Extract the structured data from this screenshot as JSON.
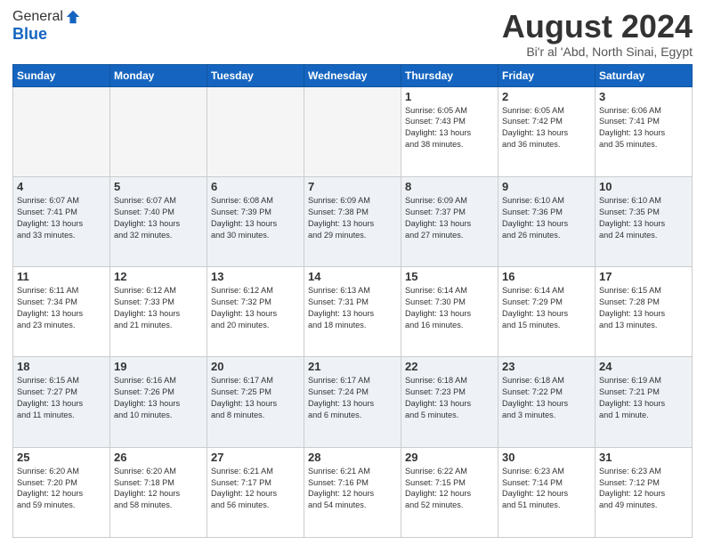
{
  "header": {
    "logo_general": "General",
    "logo_blue": "Blue",
    "month_title": "August 2024",
    "subtitle": "Bi'r al 'Abd, North Sinai, Egypt"
  },
  "days_of_week": [
    "Sunday",
    "Monday",
    "Tuesday",
    "Wednesday",
    "Thursday",
    "Friday",
    "Saturday"
  ],
  "weeks": [
    [
      {
        "day": "",
        "info": ""
      },
      {
        "day": "",
        "info": ""
      },
      {
        "day": "",
        "info": ""
      },
      {
        "day": "",
        "info": ""
      },
      {
        "day": "1",
        "info": "Sunrise: 6:05 AM\nSunset: 7:43 PM\nDaylight: 13 hours\nand 38 minutes."
      },
      {
        "day": "2",
        "info": "Sunrise: 6:05 AM\nSunset: 7:42 PM\nDaylight: 13 hours\nand 36 minutes."
      },
      {
        "day": "3",
        "info": "Sunrise: 6:06 AM\nSunset: 7:41 PM\nDaylight: 13 hours\nand 35 minutes."
      }
    ],
    [
      {
        "day": "4",
        "info": "Sunrise: 6:07 AM\nSunset: 7:41 PM\nDaylight: 13 hours\nand 33 minutes."
      },
      {
        "day": "5",
        "info": "Sunrise: 6:07 AM\nSunset: 7:40 PM\nDaylight: 13 hours\nand 32 minutes."
      },
      {
        "day": "6",
        "info": "Sunrise: 6:08 AM\nSunset: 7:39 PM\nDaylight: 13 hours\nand 30 minutes."
      },
      {
        "day": "7",
        "info": "Sunrise: 6:09 AM\nSunset: 7:38 PM\nDaylight: 13 hours\nand 29 minutes."
      },
      {
        "day": "8",
        "info": "Sunrise: 6:09 AM\nSunset: 7:37 PM\nDaylight: 13 hours\nand 27 minutes."
      },
      {
        "day": "9",
        "info": "Sunrise: 6:10 AM\nSunset: 7:36 PM\nDaylight: 13 hours\nand 26 minutes."
      },
      {
        "day": "10",
        "info": "Sunrise: 6:10 AM\nSunset: 7:35 PM\nDaylight: 13 hours\nand 24 minutes."
      }
    ],
    [
      {
        "day": "11",
        "info": "Sunrise: 6:11 AM\nSunset: 7:34 PM\nDaylight: 13 hours\nand 23 minutes."
      },
      {
        "day": "12",
        "info": "Sunrise: 6:12 AM\nSunset: 7:33 PM\nDaylight: 13 hours\nand 21 minutes."
      },
      {
        "day": "13",
        "info": "Sunrise: 6:12 AM\nSunset: 7:32 PM\nDaylight: 13 hours\nand 20 minutes."
      },
      {
        "day": "14",
        "info": "Sunrise: 6:13 AM\nSunset: 7:31 PM\nDaylight: 13 hours\nand 18 minutes."
      },
      {
        "day": "15",
        "info": "Sunrise: 6:14 AM\nSunset: 7:30 PM\nDaylight: 13 hours\nand 16 minutes."
      },
      {
        "day": "16",
        "info": "Sunrise: 6:14 AM\nSunset: 7:29 PM\nDaylight: 13 hours\nand 15 minutes."
      },
      {
        "day": "17",
        "info": "Sunrise: 6:15 AM\nSunset: 7:28 PM\nDaylight: 13 hours\nand 13 minutes."
      }
    ],
    [
      {
        "day": "18",
        "info": "Sunrise: 6:15 AM\nSunset: 7:27 PM\nDaylight: 13 hours\nand 11 minutes."
      },
      {
        "day": "19",
        "info": "Sunrise: 6:16 AM\nSunset: 7:26 PM\nDaylight: 13 hours\nand 10 minutes."
      },
      {
        "day": "20",
        "info": "Sunrise: 6:17 AM\nSunset: 7:25 PM\nDaylight: 13 hours\nand 8 minutes."
      },
      {
        "day": "21",
        "info": "Sunrise: 6:17 AM\nSunset: 7:24 PM\nDaylight: 13 hours\nand 6 minutes."
      },
      {
        "day": "22",
        "info": "Sunrise: 6:18 AM\nSunset: 7:23 PM\nDaylight: 13 hours\nand 5 minutes."
      },
      {
        "day": "23",
        "info": "Sunrise: 6:18 AM\nSunset: 7:22 PM\nDaylight: 13 hours\nand 3 minutes."
      },
      {
        "day": "24",
        "info": "Sunrise: 6:19 AM\nSunset: 7:21 PM\nDaylight: 13 hours\nand 1 minute."
      }
    ],
    [
      {
        "day": "25",
        "info": "Sunrise: 6:20 AM\nSunset: 7:20 PM\nDaylight: 12 hours\nand 59 minutes."
      },
      {
        "day": "26",
        "info": "Sunrise: 6:20 AM\nSunset: 7:18 PM\nDaylight: 12 hours\nand 58 minutes."
      },
      {
        "day": "27",
        "info": "Sunrise: 6:21 AM\nSunset: 7:17 PM\nDaylight: 12 hours\nand 56 minutes."
      },
      {
        "day": "28",
        "info": "Sunrise: 6:21 AM\nSunset: 7:16 PM\nDaylight: 12 hours\nand 54 minutes."
      },
      {
        "day": "29",
        "info": "Sunrise: 6:22 AM\nSunset: 7:15 PM\nDaylight: 12 hours\nand 52 minutes."
      },
      {
        "day": "30",
        "info": "Sunrise: 6:23 AM\nSunset: 7:14 PM\nDaylight: 12 hours\nand 51 minutes."
      },
      {
        "day": "31",
        "info": "Sunrise: 6:23 AM\nSunset: 7:12 PM\nDaylight: 12 hours\nand 49 minutes."
      }
    ]
  ]
}
